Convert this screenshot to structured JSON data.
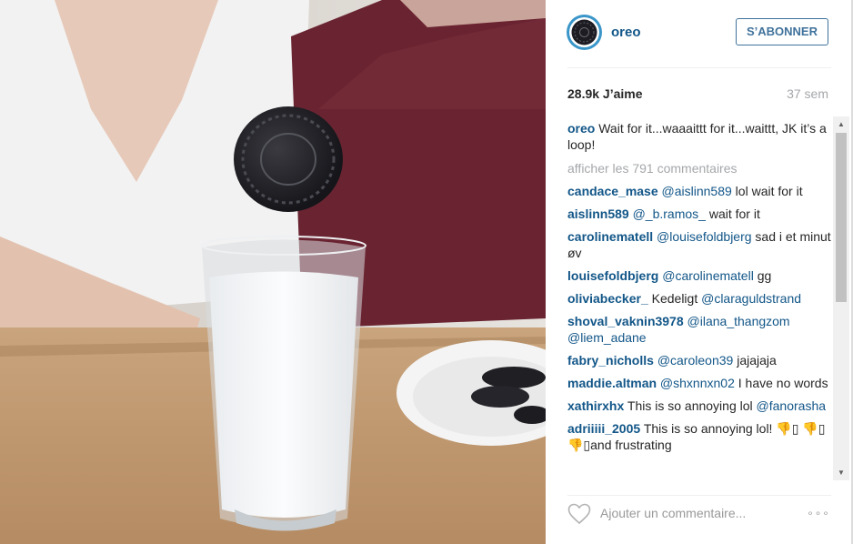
{
  "post": {
    "username": "oreo",
    "follow_label": "S’ABONNER",
    "likes": "28.9k J’aime",
    "age": "37 sem"
  },
  "caption": {
    "username": "oreo",
    "text": "Wait for it...waaaittt for it...waittt, JK it’s a loop!"
  },
  "more_comments_label": "afficher les 791 commentaires",
  "comments": [
    {
      "user": "candace_mase",
      "parts": [
        {
          "m": "@aislinn589"
        },
        {
          "t": " lol wait for it"
        }
      ]
    },
    {
      "user": "aislinn589",
      "parts": [
        {
          "m": "@_b.ramos_"
        },
        {
          "t": " wait for it"
        }
      ]
    },
    {
      "user": "carolinematell",
      "parts": [
        {
          "m": "@louisefoldbjerg"
        },
        {
          "t": " sad i et minut øv"
        }
      ]
    },
    {
      "user": "louisefoldbjerg",
      "parts": [
        {
          "m": "@carolinematell"
        },
        {
          "t": " gg"
        }
      ]
    },
    {
      "user": "oliviabecker_",
      "parts": [
        {
          "t": "Kedeligt "
        },
        {
          "m": "@claraguldstrand"
        }
      ]
    },
    {
      "user": "shoval_vaknin3978",
      "parts": [
        {
          "m": "@ilana_thangzom"
        },
        {
          "t": " "
        },
        {
          "m": "@liem_adane"
        }
      ]
    },
    {
      "user": "fabry_nicholls",
      "parts": [
        {
          "m": "@caroleon39"
        },
        {
          "t": " jajajaja"
        }
      ]
    },
    {
      "user": "maddie.altman",
      "parts": [
        {
          "m": "@shxnnxn02"
        },
        {
          "t": " I have no words"
        }
      ]
    },
    {
      "user": "xathirxhx",
      "parts": [
        {
          "t": "This is so annoying lol "
        },
        {
          "m": "@fanorasha"
        }
      ]
    },
    {
      "user": "adriiiii_2005",
      "parts": [
        {
          "t": "This is so annoying lol! 👎▯ 👎▯👎▯and frustrating"
        }
      ]
    }
  ],
  "footer": {
    "comment_placeholder": "Ajouter un commentaire...",
    "options_label": "∘∘∘"
  },
  "icons": {
    "heart": "heart-icon",
    "options": "ellipsis-icon",
    "avatar": "oreo-cookie-logo"
  },
  "colors": {
    "link_blue": "#125688",
    "button_blue": "#3f729b",
    "muted_gray": "#a5a7aa",
    "avatar_ring": "#3a96c9"
  }
}
